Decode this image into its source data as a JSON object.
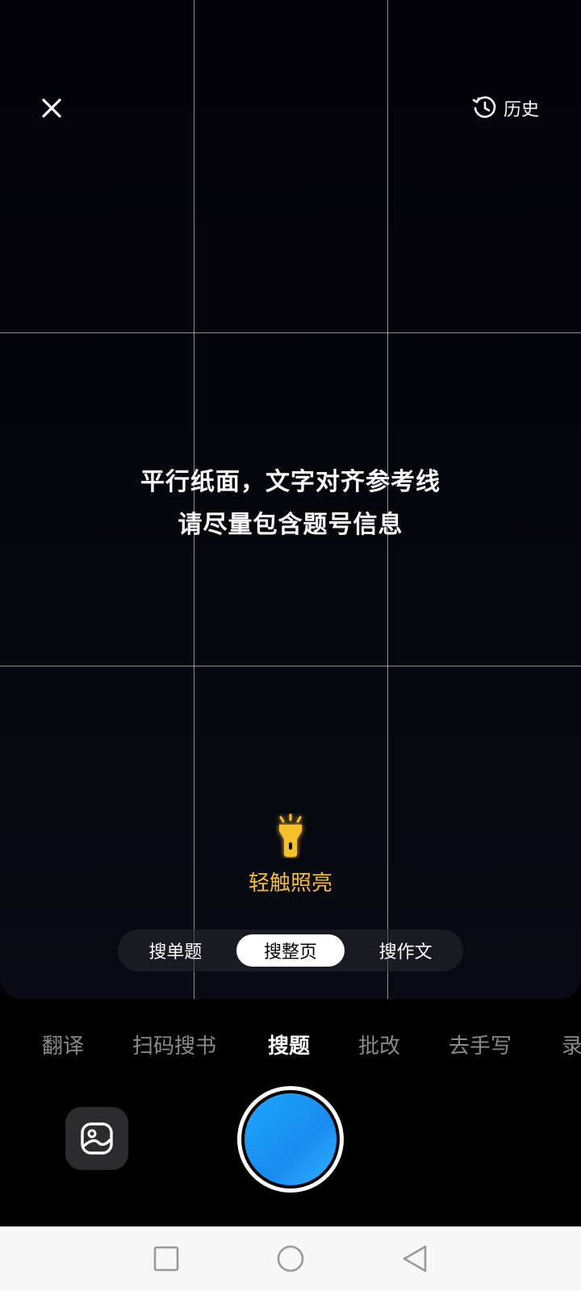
{
  "header": {
    "close_icon": "close-icon",
    "history_icon": "history-clock-icon",
    "history_label": "历史"
  },
  "hint": {
    "line1": "平行纸面，文字对齐参考线",
    "line2": "请尽量包含题号信息"
  },
  "torch": {
    "icon": "flashlight-icon",
    "label": "轻触照亮",
    "color": "#f5c02a"
  },
  "search_modes": [
    {
      "label": "搜单题",
      "active": false
    },
    {
      "label": "搜整页",
      "active": true
    },
    {
      "label": "搜作文",
      "active": false
    }
  ],
  "tabs": [
    {
      "label": "翻译",
      "active": false
    },
    {
      "label": "扫码搜书",
      "active": false
    },
    {
      "label": "搜题",
      "active": true
    },
    {
      "label": "批改",
      "active": false
    },
    {
      "label": "去手写",
      "active": false
    },
    {
      "label": "录",
      "active": false
    }
  ],
  "controls": {
    "gallery_icon": "gallery-icon",
    "shutter_color": "#1aa6ff"
  },
  "system_nav": {
    "recents_icon": "square-recents-icon",
    "home_icon": "circle-home-icon",
    "back_icon": "triangle-back-icon"
  }
}
